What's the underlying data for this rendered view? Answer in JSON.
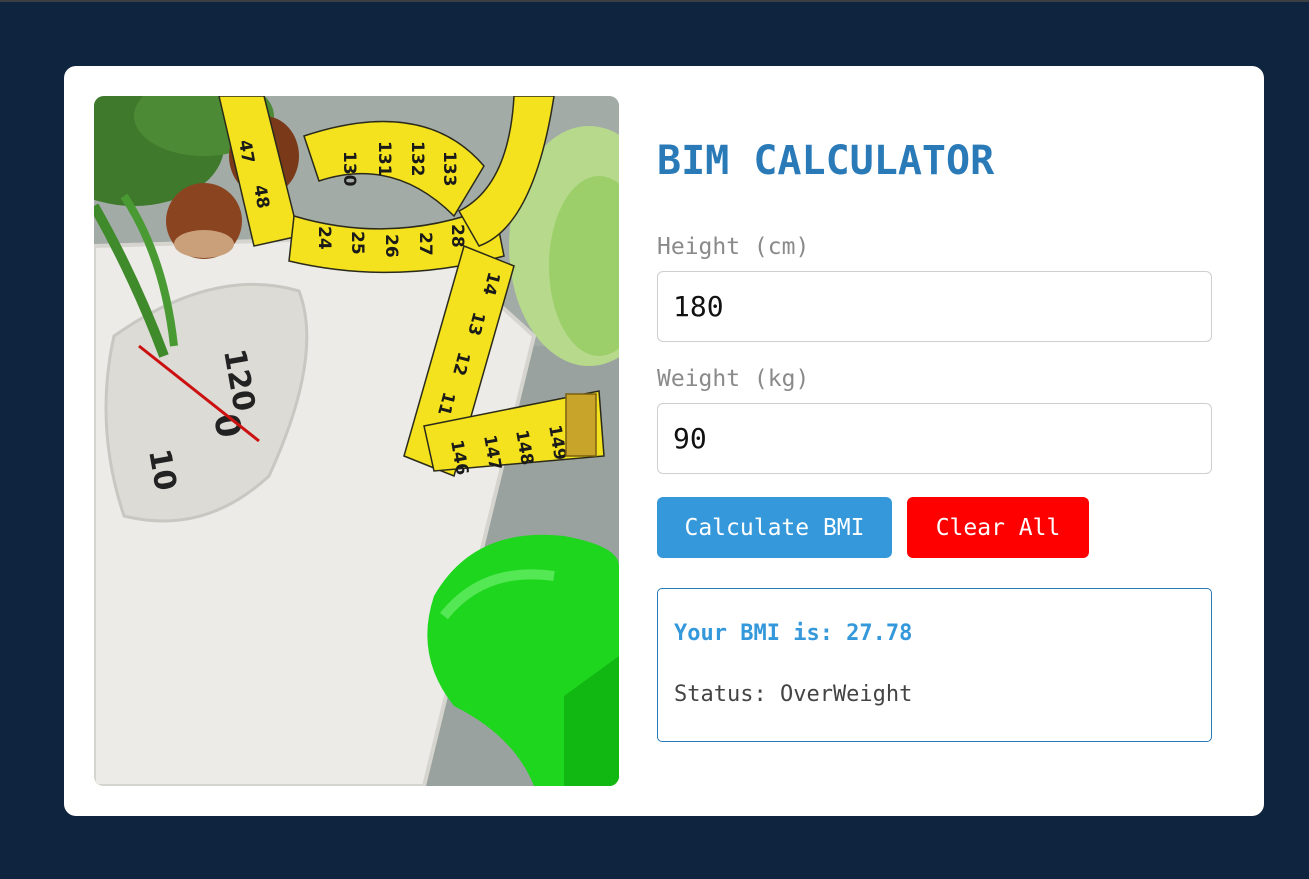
{
  "app": {
    "title": "BIM CALCULATOR"
  },
  "form": {
    "height_label": "Height (cm)",
    "height_value": "180",
    "weight_label": "Weight (kg)",
    "weight_value": "90"
  },
  "buttons": {
    "calculate_label": "Calculate BMI",
    "clear_label": "Clear All"
  },
  "result": {
    "bmi_text": "Your BMI is: 27.78",
    "status_text": "Status: OverWeight"
  },
  "image": {
    "description_icon": "scale-tape-dumbbell-photo",
    "scale_numbers": [
      "120",
      "0",
      "10"
    ],
    "tape_numbers": [
      "47",
      "48",
      "130",
      "131",
      "132",
      "133",
      "24",
      "25",
      "26",
      "27",
      "28",
      "14",
      "13",
      "12",
      "11",
      "146",
      "147",
      "148",
      "149"
    ]
  },
  "colors": {
    "background": "#0f243f",
    "card": "#ffffff",
    "title": "#2a7ab8",
    "calculate_button": "#3498db",
    "clear_button": "#ff0000",
    "result_border": "#2a7ab8",
    "bmi_text": "#3498db"
  }
}
